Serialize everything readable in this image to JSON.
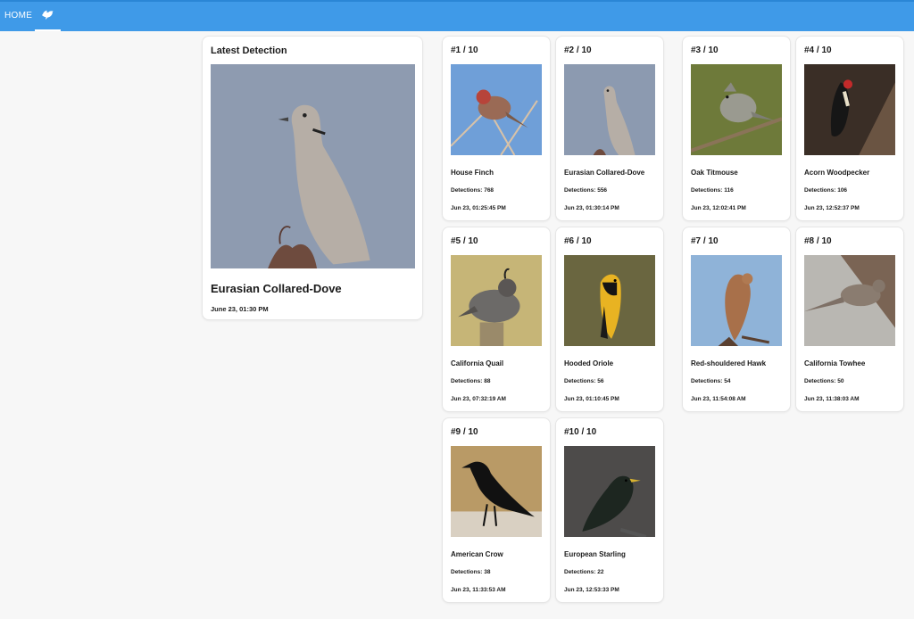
{
  "nav": {
    "home_label": "HOME",
    "bird_icon": "bird-icon"
  },
  "latest": {
    "title": "Latest Detection",
    "species": "Eurasian Collared-Dove",
    "time": "June 23, 01:30 PM"
  },
  "birds": [
    {
      "rank": "#1 / 10",
      "name": "House Finch",
      "detections": "Detections: 768",
      "last_seen": "Jun 23, 01:25:45 PM"
    },
    {
      "rank": "#2 / 10",
      "name": "Eurasian Collared-Dove",
      "detections": "Detections: 556",
      "last_seen": "Jun 23, 01:30:14 PM"
    },
    {
      "rank": "#3 / 10",
      "name": "Oak Titmouse",
      "detections": "Detections: 116",
      "last_seen": "Jun 23, 12:02:41 PM"
    },
    {
      "rank": "#4 / 10",
      "name": "Acorn Woodpecker",
      "detections": "Detections: 106",
      "last_seen": "Jun 23, 12:52:37 PM"
    },
    {
      "rank": "#5 / 10",
      "name": "California Quail",
      "detections": "Detections: 88",
      "last_seen": "Jun 23, 07:32:19 AM"
    },
    {
      "rank": "#6 / 10",
      "name": "Hooded Oriole",
      "detections": "Detections: 56",
      "last_seen": "Jun 23, 01:10:45 PM"
    },
    {
      "rank": "#7 / 10",
      "name": "Red-shouldered Hawk",
      "detections": "Detections: 54",
      "last_seen": "Jun 23, 11:54:08 AM"
    },
    {
      "rank": "#8 / 10",
      "name": "California Towhee",
      "detections": "Detections: 50",
      "last_seen": "Jun 23, 11:38:03 AM"
    },
    {
      "rank": "#9 / 10",
      "name": "American Crow",
      "detections": "Detections: 38",
      "last_seen": "Jun 23, 11:33:53 AM"
    },
    {
      "rank": "#10 / 10",
      "name": "European Starling",
      "detections": "Detections: 22",
      "last_seen": "Jun 23, 12:53:33 PM"
    }
  ],
  "colors": {
    "nav_bar": "#3f9ae8",
    "page_background": "#f7f7f7",
    "card_background": "#ffffff"
  }
}
